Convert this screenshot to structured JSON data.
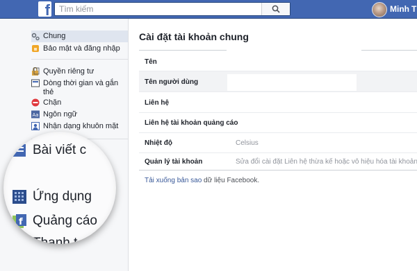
{
  "header": {
    "logo_letter": "f",
    "search_placeholder": "Tìm kiếm",
    "user_name": "Minh",
    "right_cut": "T",
    "brand_color": "#4267b2"
  },
  "sidebar": {
    "items": [
      {
        "label": "Chung",
        "icon": "gear-icon"
      },
      {
        "label": "Bảo mật và đăng nhập",
        "icon": "shield-icon"
      },
      {
        "label": "Quyền riêng tư",
        "icon": "lock-icon"
      },
      {
        "label": "Dòng thời gian và gắn thẻ",
        "icon": "timeline-icon"
      },
      {
        "label": "Chặn",
        "icon": "block-icon"
      },
      {
        "label": "Ngôn ngữ",
        "icon": "language-icon"
      },
      {
        "label": "Nhận dạng khuôn mặt",
        "icon": "face-icon"
      }
    ],
    "magnified": [
      {
        "label": "Bài viết c",
        "icon": "posts-icon"
      },
      {
        "label": "Ứng dụng",
        "icon": "apps-icon"
      },
      {
        "label": "Quảng cáo",
        "icon": "ads-icon"
      },
      {
        "label": "Thanh t",
        "icon": "payments-icon"
      }
    ]
  },
  "main": {
    "title": "Cài đặt tài khoản chung",
    "rows": [
      {
        "label": "Tên",
        "value": ""
      },
      {
        "label": "Tên người dùng",
        "value": ""
      },
      {
        "label": "Liên hệ",
        "value": ""
      },
      {
        "label": "Liên hệ tài khoản quảng cáo",
        "value": ""
      },
      {
        "label": "Nhiệt độ",
        "value": "Celsius"
      },
      {
        "label": "Quản lý tài khoản",
        "value": "Sửa đổi cài đặt Liên hệ thừa kế hoặc vô hiệu hóa tài khoản củ"
      }
    ],
    "download_link": "Tải xuống bản sao",
    "download_rest": " dữ liệu Facebook."
  }
}
